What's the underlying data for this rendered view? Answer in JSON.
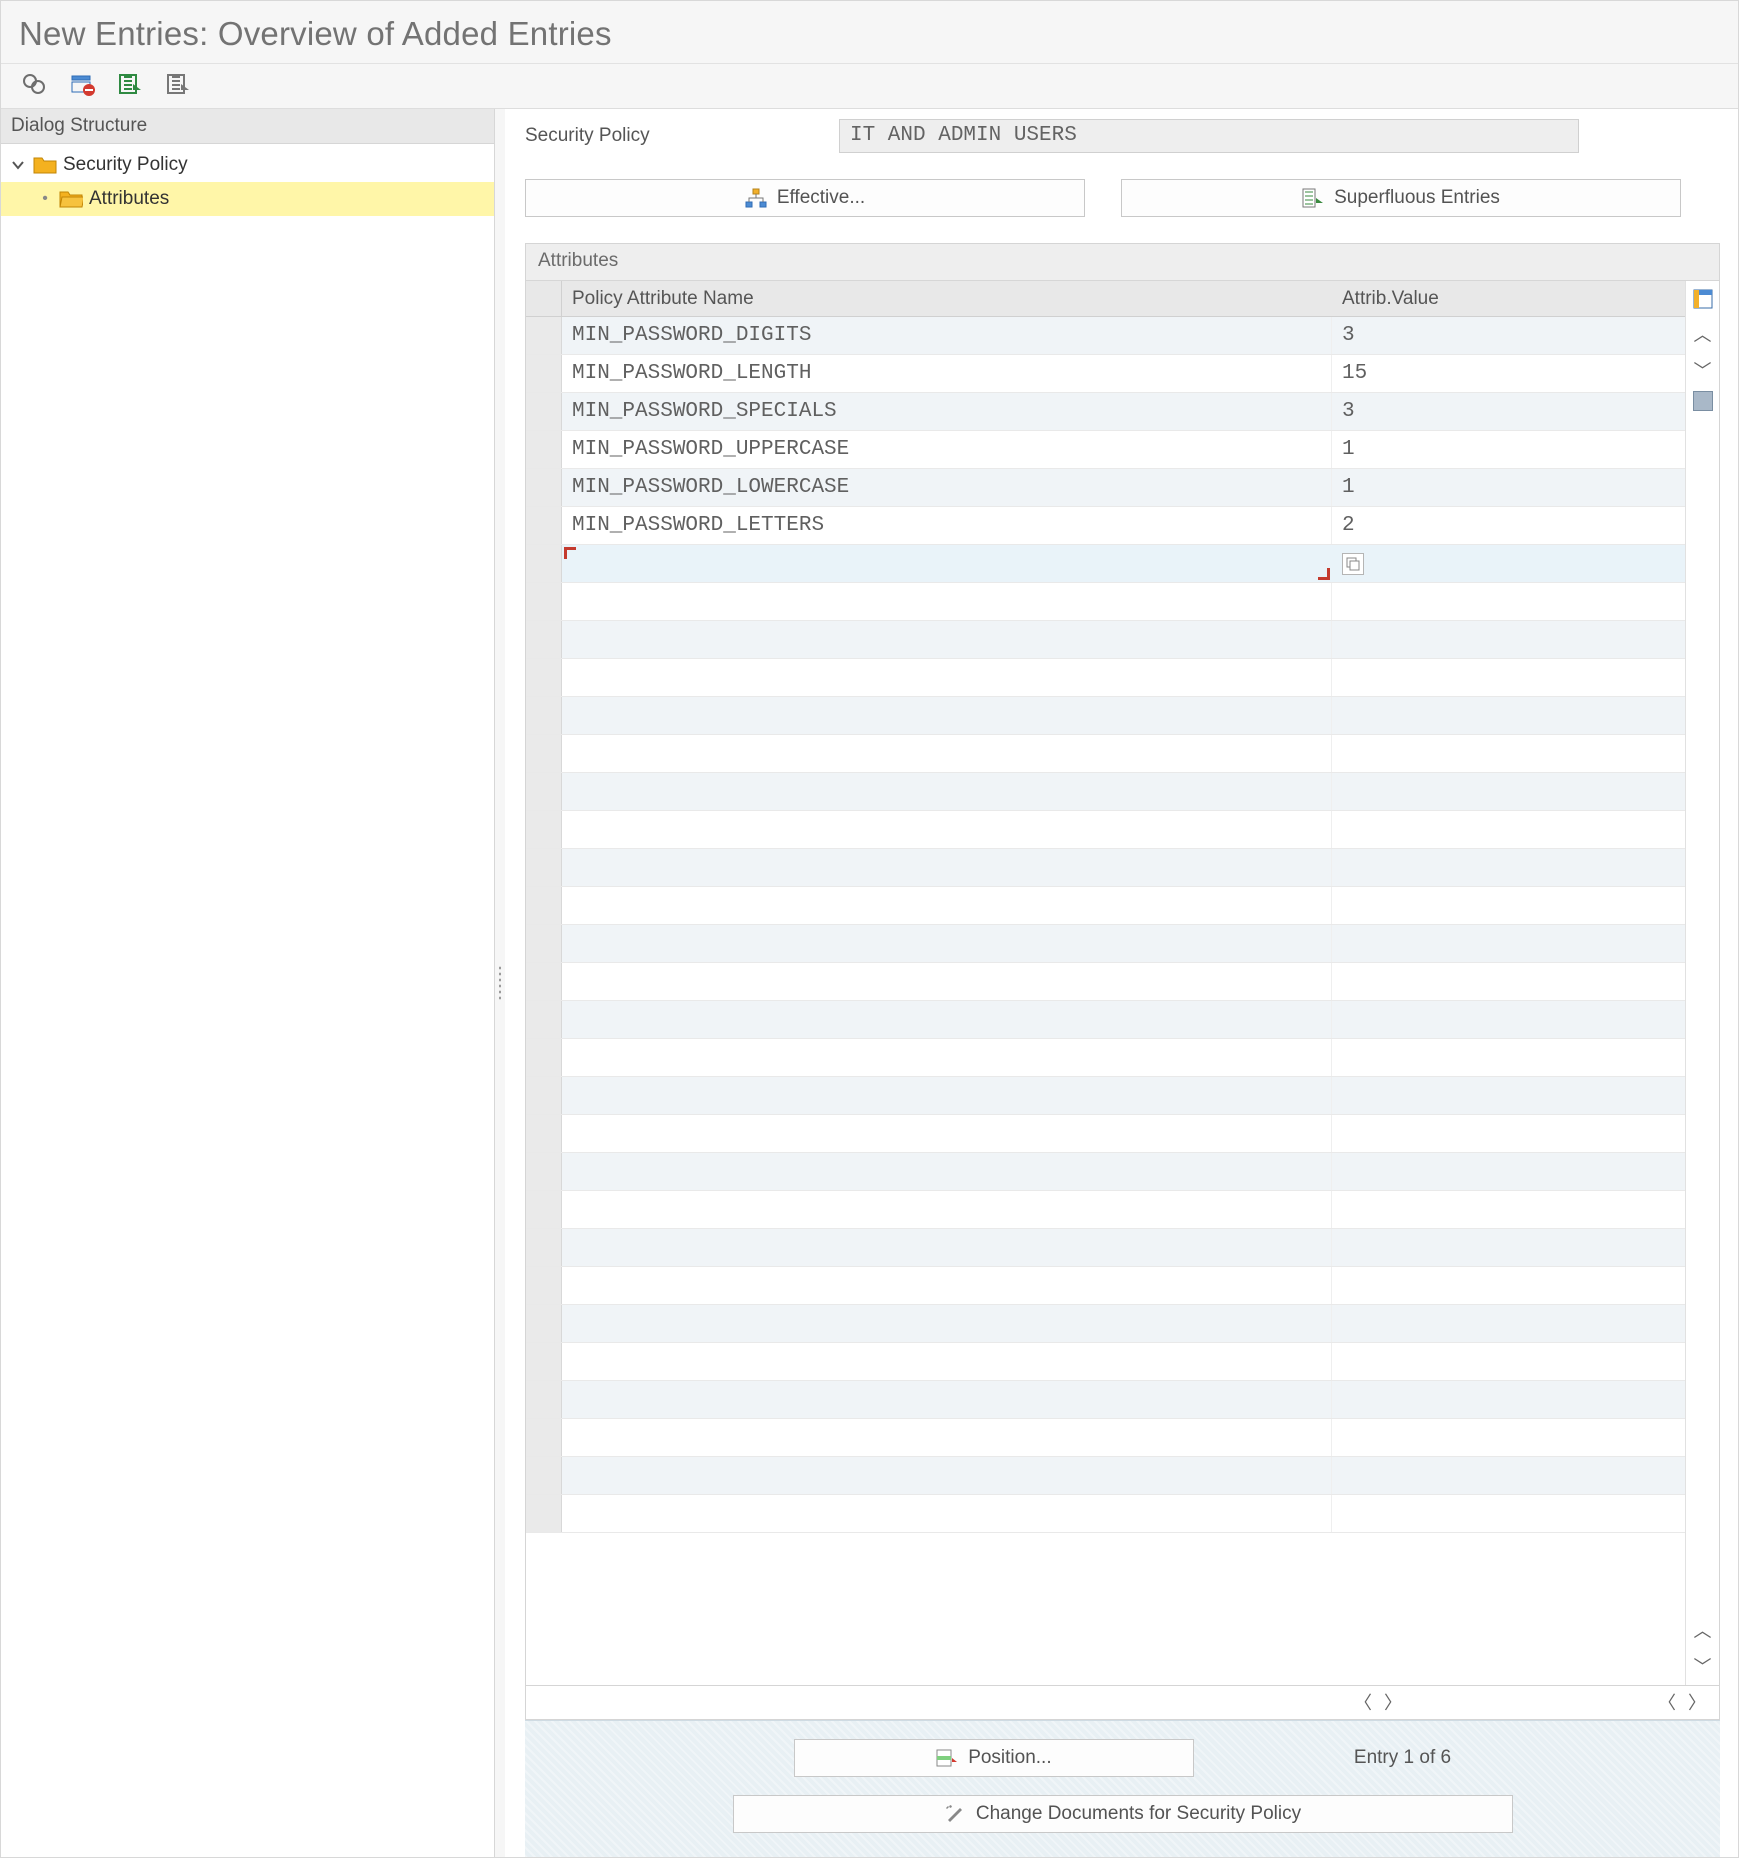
{
  "title": "New Entries: Overview of Added Entries",
  "left": {
    "header": "Dialog Structure",
    "tree": {
      "root_label": "Security Policy",
      "child_label": "Attributes"
    }
  },
  "policy": {
    "label": "Security Policy",
    "value": "IT AND ADMIN USERS"
  },
  "buttons": {
    "effective": "Effective...",
    "superfluous": "Superfluous Entries"
  },
  "grid": {
    "title": "Attributes",
    "head_name": "Policy Attribute Name",
    "head_value": "Attrib.Value",
    "rows": [
      {
        "name": "MIN_PASSWORD_DIGITS",
        "value": "3"
      },
      {
        "name": "MIN_PASSWORD_LENGTH",
        "value": "15"
      },
      {
        "name": "MIN_PASSWORD_SPECIALS",
        "value": "3"
      },
      {
        "name": "MIN_PASSWORD_UPPERCASE",
        "value": "1"
      },
      {
        "name": "MIN_PASSWORD_LOWERCASE",
        "value": "1"
      },
      {
        "name": "MIN_PASSWORD_LETTERS",
        "value": "2"
      }
    ]
  },
  "footer": {
    "position": "Position...",
    "entry_info": "Entry 1 of 6",
    "change_docs": "Change Documents for Security Policy"
  }
}
